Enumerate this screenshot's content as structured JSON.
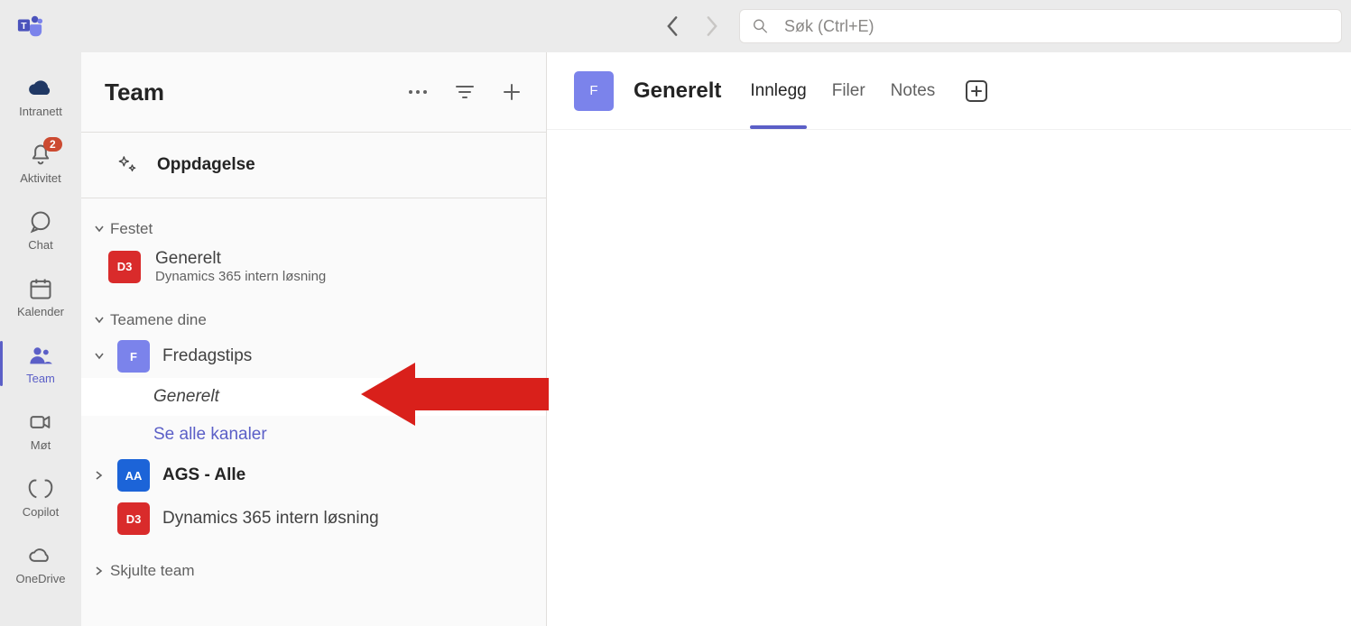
{
  "search": {
    "placeholder": "Søk (Ctrl+E)"
  },
  "rail": {
    "intranett": "Intranett",
    "aktivitet": "Aktivitet",
    "aktivitet_badge": "2",
    "chat": "Chat",
    "kalender": "Kalender",
    "team": "Team",
    "mot": "Møt",
    "copilot": "Copilot",
    "onedrive": "OneDrive"
  },
  "panel": {
    "title": "Team",
    "discovery": "Oppdagelse",
    "pinned_head": "Festet",
    "pinned": {
      "title": "Generelt",
      "sub": "Dynamics 365 intern løsning",
      "initials": "D3"
    },
    "yours_head": "Teamene dine",
    "teams": [
      {
        "initials": "F",
        "name": "Fredagstips",
        "color": "紫",
        "expanded": true,
        "channels": [
          {
            "label": "Generelt",
            "selected": true
          },
          {
            "label": "Se alle kanaler",
            "link": true
          }
        ]
      },
      {
        "initials": "AA",
        "name": "AGS - Alle",
        "color": "蓝",
        "bold": true
      },
      {
        "initials": "D3",
        "name": "Dynamics 365 intern løsning",
        "color": "红"
      }
    ],
    "hidden_head": "Skjulte team"
  },
  "content": {
    "avatar": "F",
    "title": "Generelt",
    "tabs": [
      "Innlegg",
      "Filer",
      "Notes"
    ],
    "active_tab": 0
  }
}
